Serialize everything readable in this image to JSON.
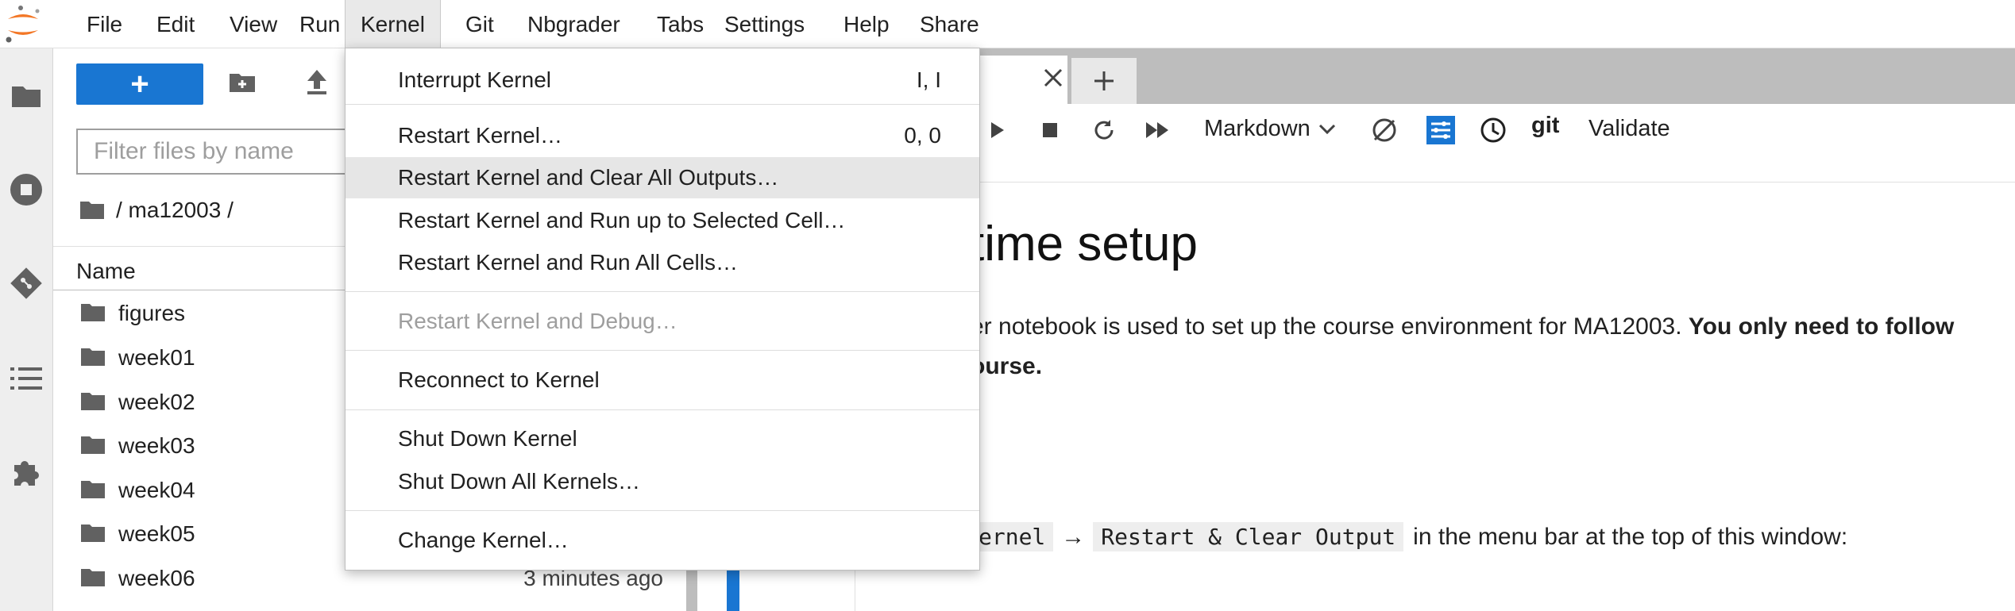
{
  "menubar": {
    "items": [
      "File",
      "Edit",
      "View",
      "Run",
      "Kernel",
      "Git",
      "Nbgrader",
      "Tabs",
      "Settings",
      "Help",
      "Share"
    ],
    "active": "Kernel"
  },
  "kernel_menu": {
    "items": [
      {
        "label": "Interrupt Kernel",
        "shortcut": "I, I"
      },
      {
        "label": "Restart Kernel…",
        "shortcut": "0, 0"
      },
      {
        "label": "Restart Kernel and Clear All Outputs…",
        "shortcut": ""
      },
      {
        "label": "Restart Kernel and Run up to Selected Cell…",
        "shortcut": ""
      },
      {
        "label": "Restart Kernel and Run All Cells…",
        "shortcut": ""
      },
      {
        "label": "Restart Kernel and Debug…",
        "shortcut": ""
      },
      {
        "label": "Reconnect to Kernel",
        "shortcut": ""
      },
      {
        "label": "Shut Down Kernel",
        "shortcut": ""
      },
      {
        "label": "Shut Down All Kernels…",
        "shortcut": ""
      },
      {
        "label": "Change Kernel…",
        "shortcut": ""
      }
    ]
  },
  "filebrowser": {
    "new_label": "+",
    "filter_placeholder": "Filter files by name",
    "breadcrumb": "/ ma12003 /",
    "name_header": "Name",
    "files": [
      {
        "name": "figures",
        "modified": ""
      },
      {
        "name": "week01",
        "modified": ""
      },
      {
        "name": "week02",
        "modified": ""
      },
      {
        "name": "week03",
        "modified": ""
      },
      {
        "name": "week04",
        "modified": ""
      },
      {
        "name": "week05",
        "modified": ""
      },
      {
        "name": "week06",
        "modified": "3 minutes ago"
      }
    ]
  },
  "notebook": {
    "cell_type": "Markdown",
    "git_label": "git",
    "validate_label": "Validate",
    "heading": "time setup",
    "para_text": "er notebook is used to set up the course environment for MA12003.",
    "para_bold": "You only need to follow",
    "para_line2": "ourse.",
    "colon": ":",
    "code1": "ernel",
    "arrow": "→",
    "code2": "Restart & Clear Output",
    "line_tail": "in the menu bar at the top of this window:"
  },
  "colors": {
    "accent": "#1976d2",
    "menu_active_bg": "#e9e9e9",
    "highlight_bg": "#e6e6e6",
    "disabled_text": "#9e9e9e"
  }
}
